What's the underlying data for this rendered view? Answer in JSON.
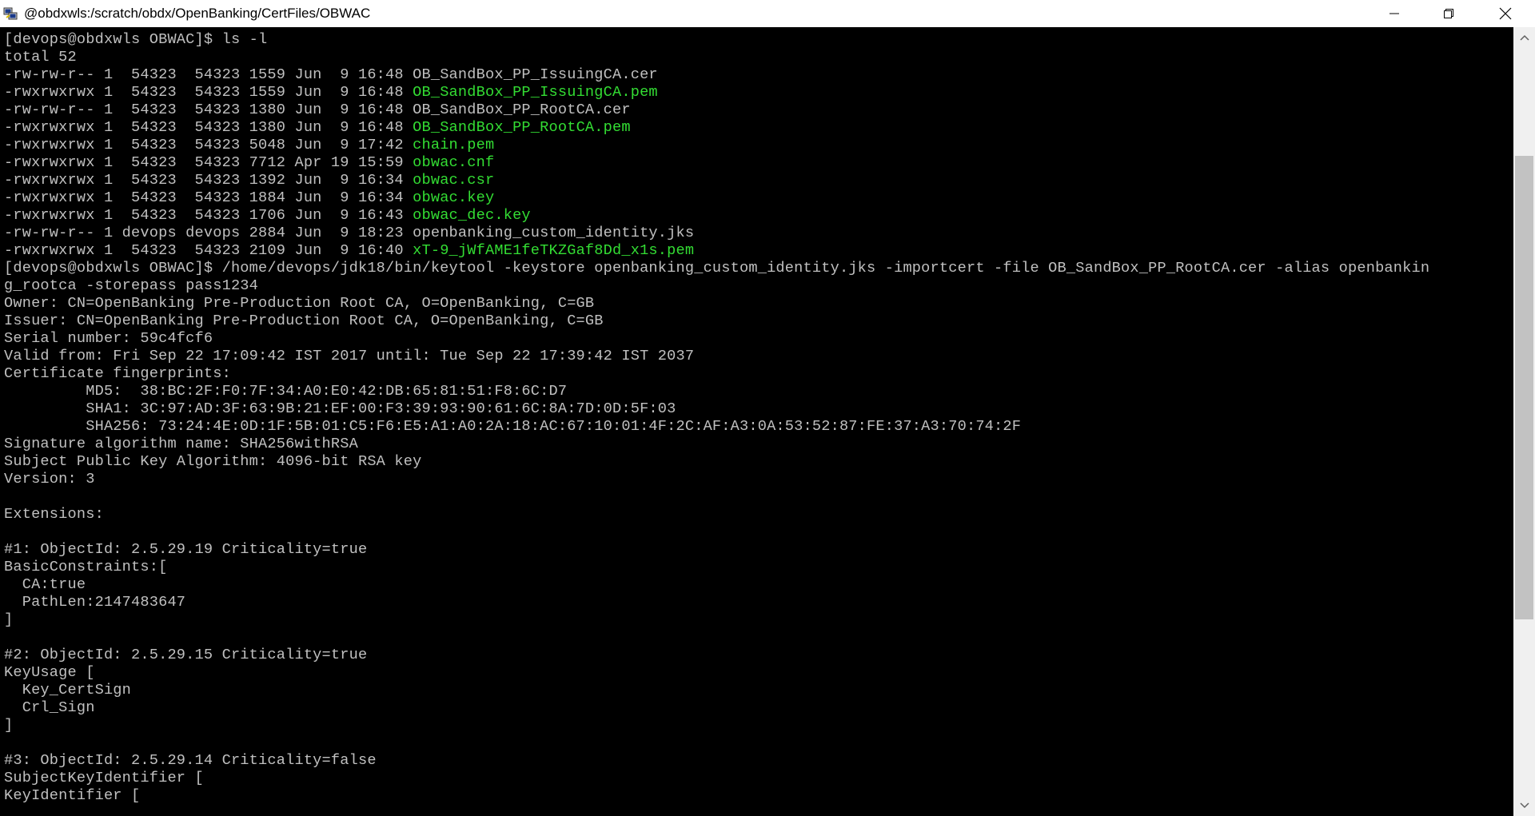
{
  "window": {
    "title": "@obdxwls:/scratch/obdx/OpenBanking/CertFiles/OBWAC",
    "icon": "putty-icon",
    "buttons": [
      "minimize-icon",
      "restore-icon",
      "close-icon"
    ]
  },
  "colors": {
    "background": "#000000",
    "text": "#c0c0c0",
    "highlight": "#33dd33"
  },
  "terminal": {
    "lines": [
      {
        "text": "[devops@obdxwls OBWAC]$ ls -l"
      },
      {
        "text": "total 52"
      },
      {
        "text": "-rw-rw-r-- 1  54323  54323 1559 Jun  9 16:48 ",
        "file": "OB_SandBox_PP_IssuingCA.cer",
        "file_color": "default"
      },
      {
        "text": "-rwxrwxrwx 1  54323  54323 1559 Jun  9 16:48 ",
        "file": "OB_SandBox_PP_IssuingCA.pem",
        "file_color": "green"
      },
      {
        "text": "-rw-rw-r-- 1  54323  54323 1380 Jun  9 16:48 ",
        "file": "OB_SandBox_PP_RootCA.cer",
        "file_color": "default"
      },
      {
        "text": "-rwxrwxrwx 1  54323  54323 1380 Jun  9 16:48 ",
        "file": "OB_SandBox_PP_RootCA.pem",
        "file_color": "green"
      },
      {
        "text": "-rwxrwxrwx 1  54323  54323 5048 Jun  9 17:42 ",
        "file": "chain.pem",
        "file_color": "green"
      },
      {
        "text": "-rwxrwxrwx 1  54323  54323 7712 Apr 19 15:59 ",
        "file": "obwac.cnf",
        "file_color": "green"
      },
      {
        "text": "-rwxrwxrwx 1  54323  54323 1392 Jun  9 16:34 ",
        "file": "obwac.csr",
        "file_color": "green"
      },
      {
        "text": "-rwxrwxrwx 1  54323  54323 1884 Jun  9 16:34 ",
        "file": "obwac.key",
        "file_color": "green"
      },
      {
        "text": "-rwxrwxrwx 1  54323  54323 1706 Jun  9 16:43 ",
        "file": "obwac_dec.key",
        "file_color": "green"
      },
      {
        "text": "-rw-rw-r-- 1 devops devops 2884 Jun  9 18:23 ",
        "file": "openbanking_custom_identity.jks",
        "file_color": "default"
      },
      {
        "text": "-rwxrwxrwx 1  54323  54323 2109 Jun  9 16:40 ",
        "file": "xT-9_jWfAME1feTKZGaf8Dd_x1s.pem",
        "file_color": "green"
      },
      {
        "text": "[devops@obdxwls OBWAC]$ /home/devops/jdk18/bin/keytool -keystore openbanking_custom_identity.jks -importcert -file OB_SandBox_PP_RootCA.cer -alias openbankin"
      },
      {
        "text": "g_rootca -storepass pass1234"
      },
      {
        "text": "Owner: CN=OpenBanking Pre-Production Root CA, O=OpenBanking, C=GB"
      },
      {
        "text": "Issuer: CN=OpenBanking Pre-Production Root CA, O=OpenBanking, C=GB"
      },
      {
        "text": "Serial number: 59c4fcf6"
      },
      {
        "text": "Valid from: Fri Sep 22 17:09:42 IST 2017 until: Tue Sep 22 17:39:42 IST 2037"
      },
      {
        "text": "Certificate fingerprints:"
      },
      {
        "text": "         MD5:  38:BC:2F:F0:7F:34:A0:E0:42:DB:65:81:51:F8:6C:D7"
      },
      {
        "text": "         SHA1: 3C:97:AD:3F:63:9B:21:EF:00:F3:39:93:90:61:6C:8A:7D:0D:5F:03"
      },
      {
        "text": "         SHA256: 73:24:4E:0D:1F:5B:01:C5:F6:E5:A1:A0:2A:18:AC:67:10:01:4F:2C:AF:A3:0A:53:52:87:FE:37:A3:70:74:2F"
      },
      {
        "text": "Signature algorithm name: SHA256withRSA"
      },
      {
        "text": "Subject Public Key Algorithm: 4096-bit RSA key"
      },
      {
        "text": "Version: 3"
      },
      {
        "text": ""
      },
      {
        "text": "Extensions:"
      },
      {
        "text": ""
      },
      {
        "text": "#1: ObjectId: 2.5.29.19 Criticality=true"
      },
      {
        "text": "BasicConstraints:["
      },
      {
        "text": "  CA:true"
      },
      {
        "text": "  PathLen:2147483647"
      },
      {
        "text": "]"
      },
      {
        "text": ""
      },
      {
        "text": "#2: ObjectId: 2.5.29.15 Criticality=true"
      },
      {
        "text": "KeyUsage ["
      },
      {
        "text": "  Key_CertSign"
      },
      {
        "text": "  Crl_Sign"
      },
      {
        "text": "]"
      },
      {
        "text": ""
      },
      {
        "text": "#3: ObjectId: 2.5.29.14 Criticality=false"
      },
      {
        "text": "SubjectKeyIdentifier ["
      },
      {
        "text": "KeyIdentifier ["
      }
    ]
  },
  "scrollbar": {
    "position_fraction": 0.38
  }
}
